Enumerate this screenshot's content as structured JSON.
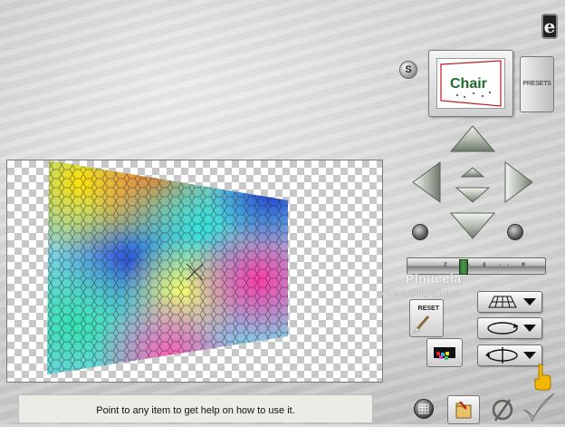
{
  "logo": {
    "glyph": "e"
  },
  "s_button": {
    "label": "S"
  },
  "preset": {
    "thumbnail_text": "Chair",
    "button_label": "PRESETS"
  },
  "zoom": {
    "tick_text": "Z ·· 0 ·· M"
  },
  "watermark": {
    "name": "Pinuccia",
    "url": "www.maidigrafica.eu"
  },
  "reset": {
    "label": "RESET"
  },
  "status": {
    "text": "Point to any item to get help on how to use it."
  },
  "icons": {
    "app_logo": "app-logo-icon",
    "nav_up": "arrow-up-icon",
    "nav_down": "arrow-down-icon",
    "nav_left": "arrow-left-icon",
    "nav_right": "arrow-right-icon",
    "mode_plane": "perspective-plane-icon",
    "mode_rotate": "rotate-ellipse-icon",
    "mode_flip": "flip-ellipse-icon",
    "grid": "grid-icon",
    "open": "open-folder-icon",
    "cancel": "cancel-icon",
    "ok": "checkmark-icon",
    "help": "help-hand-icon"
  },
  "colors": {
    "background": "#cfcfcf",
    "status_bg": "#ecebe6",
    "slider_thumb": "#3f8a3f",
    "help_hand": "#f2b705"
  }
}
